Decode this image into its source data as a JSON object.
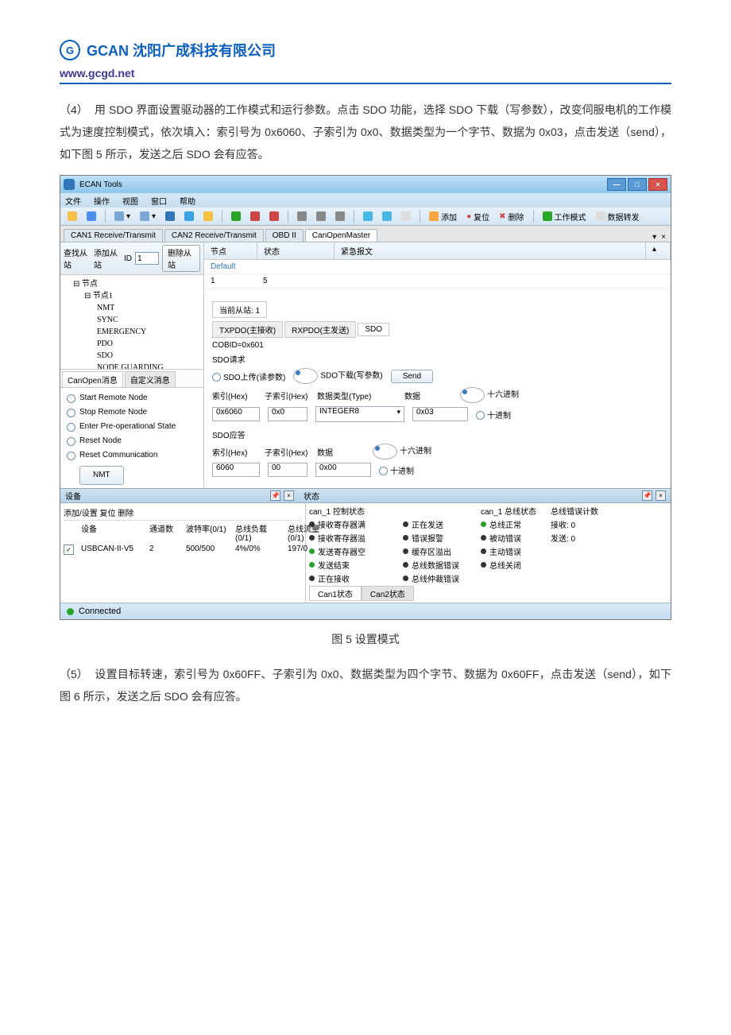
{
  "header": {
    "company": "GCAN 沈阳广成科技有限公司",
    "url": "www.gcgd.net"
  },
  "para4_num": "（4）",
  "para4": "用 SDO 界面设置驱动器的工作模式和运行参数。点击 SDO 功能，选择 SDO 下载（写参数），改变伺服电机的工作模式为速度控制模式，依次填入：索引号为 0x6060、子索引为 0x0、数据类型为一个字节、数据为 0x03，点击发送（send），如下图 5 所示，发送之后 SDO 会有应答。",
  "fig5": "图 5 设置模式",
  "para5_num": "（5）",
  "para5": "设置目标转速，索引号为 0x60FF、子索引为 0x0、数据类型为四个字节、数据为 0x60FF，点击发送（send），如下图 6 所示，发送之后 SDO 会有应答。",
  "app": {
    "title": "ECAN Tools",
    "menu": [
      "文件",
      "操作",
      "视图",
      "窗口",
      "帮助"
    ],
    "toolbar": {
      "add": "添加",
      "reset": "复位",
      "del": "删除",
      "mode": "工作模式",
      "trig": "数据转发"
    },
    "chantabs": [
      "CAN1 Receive/Transmit",
      "CAN2 Receive/Transmit",
      "OBD II",
      "CanOpenMaster"
    ],
    "left": {
      "find": "查找从站",
      "add": "添加从站",
      "id_lbl": "ID",
      "id_val": "1",
      "delbtn": "删除从站",
      "tree": [
        "节点",
        "节点1",
        "NMT",
        "SYNC",
        "EMERGENCY",
        "PDO",
        "SDO",
        "NODE GUARDING"
      ],
      "tab1": "CanOpen消息",
      "tab2": "自定义消息",
      "ops": [
        "Start Remote Node",
        "Stop Remote Node",
        "Enter Pre-operational State",
        "Reset Node",
        "Reset Communication"
      ],
      "nmt_btn": "NMT"
    },
    "grid": {
      "c1": "节点",
      "c2": "状态",
      "c3": "紧急报文",
      "r1c1": "Default",
      "r2c1": "1",
      "r2c2": "5"
    },
    "sdo": {
      "cur": "当前从站: 1",
      "tab_rx": "TXPDO(主接收)",
      "tab_tx": "RXPDO(主发送)",
      "tab_sdo": "SDO",
      "cobid": "COBID=0x601",
      "req": "SDO请求",
      "opt_up": "SDO上传(读参数)",
      "opt_dn": "SDO下载(写参数)",
      "send": "Send",
      "h_idx": "索引(Hex)",
      "h_sub": "子索引(Hex)",
      "h_type": "数据类型(Type)",
      "h_data": "数据",
      "h_hex": "十六进制",
      "h_dec": "十进制",
      "v_idx": "0x6060",
      "v_sub": "0x0",
      "v_type": "INTEGER8",
      "v_data": "0x03",
      "resp": "SDO应答",
      "r_idx": "6060",
      "r_sub": "00",
      "r_data": "0x00"
    },
    "pnl_dev": "设备",
    "pnl_stat": "状态",
    "dev": {
      "bar": "添加/设置  复位  删除",
      "h": [
        "设备",
        "通道数",
        "波特率(0/1)",
        "总线负载(0/1)",
        "总线流量(0/1)"
      ],
      "name": "USBCAN-II-V5",
      "ch": "2",
      "baud": "500/500",
      "load": "4%/0%",
      "flow": "197/0"
    },
    "stat": {
      "t1": "can_1 控制状态",
      "t2": "can_1 总线状态",
      "t3": "总线错误计数",
      "a": [
        "接收寄存器满",
        "接收寄存器溢",
        "发送寄存器空",
        "发送结束",
        "正在接收"
      ],
      "b": [
        "正在发送",
        "错误报警",
        "缓存区溢出",
        "总线数据错误",
        "总线仲裁错误"
      ],
      "c": [
        "总线正常",
        "被动错误",
        "主动错误",
        "总线关闭"
      ],
      "rx": "接收: 0",
      "tx": "发送: 0",
      "tabs": [
        "Can1状态",
        "Can2状态"
      ]
    },
    "status": "Connected"
  }
}
